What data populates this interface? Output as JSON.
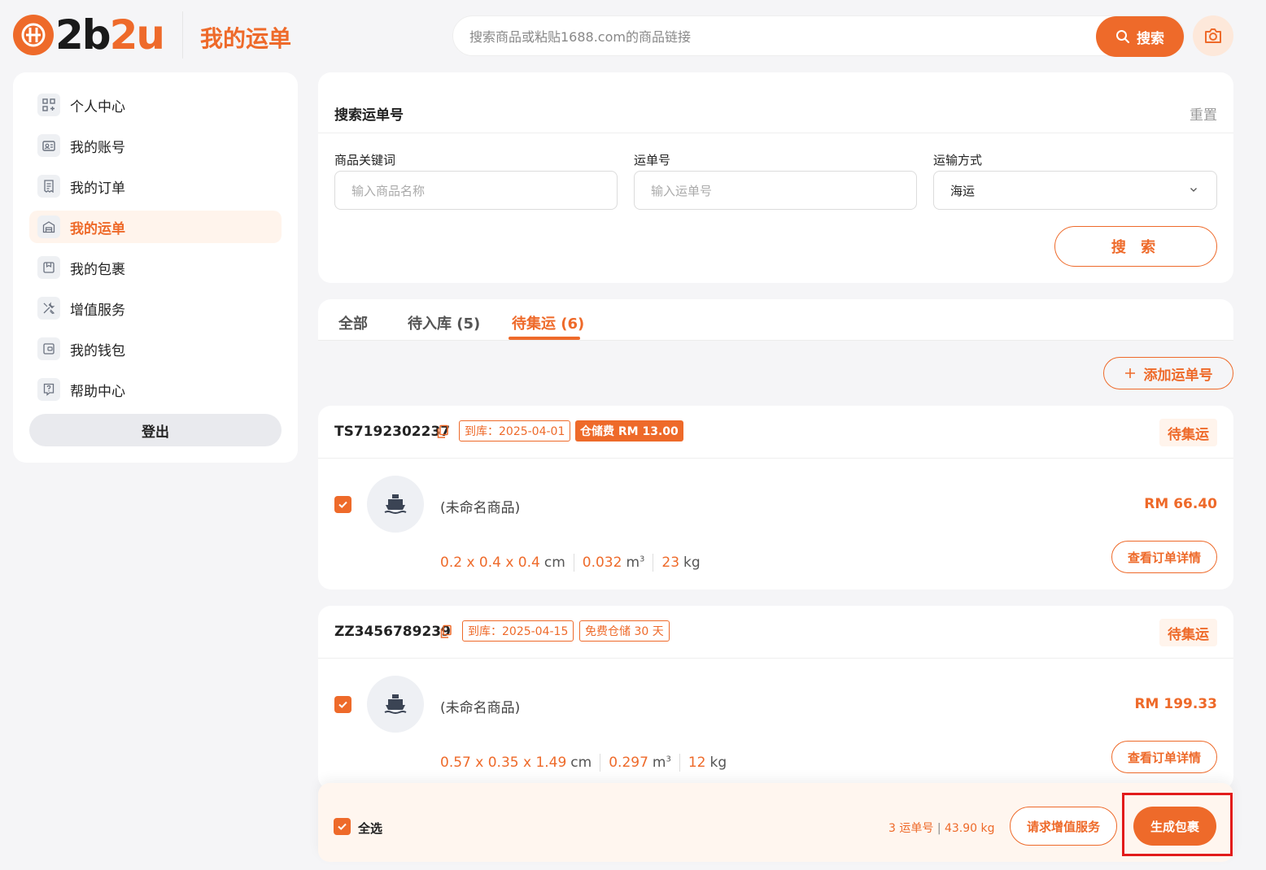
{
  "header": {
    "logo_text_a": "2b",
    "logo_text_b": "2u",
    "page_title": "我的运单",
    "search_placeholder": "搜索商品或粘贴1688.com的商品链接",
    "search_button": "搜索"
  },
  "sidebar": {
    "items": [
      {
        "label": "个人中心",
        "icon": "grid-icon"
      },
      {
        "label": "我的账号",
        "icon": "id-card-icon"
      },
      {
        "label": "我的订单",
        "icon": "receipt-icon"
      },
      {
        "label": "我的运单",
        "icon": "warehouse-icon",
        "active": true
      },
      {
        "label": "我的包裹",
        "icon": "package-icon"
      },
      {
        "label": "增值服务",
        "icon": "tools-icon"
      },
      {
        "label": "我的钱包",
        "icon": "wallet-icon"
      },
      {
        "label": "帮助中心",
        "icon": "help-icon"
      }
    ],
    "logout": "登出"
  },
  "filter": {
    "title": "搜索运单号",
    "reset": "重置",
    "keyword_label": "商品关键词",
    "keyword_placeholder": "输入商品名称",
    "waybill_label": "运单号",
    "waybill_placeholder": "输入运单号",
    "method_label": "运输方式",
    "method_value": "海运",
    "search_button": "搜 索"
  },
  "tabs": [
    {
      "label": "全部"
    },
    {
      "label": "待入库 (5)"
    },
    {
      "label": "待集运 (6)",
      "active": true
    }
  ],
  "add_waybill": "添加运单号",
  "waybills": [
    {
      "number": "TS7192302237",
      "arrival_tag": "到库：2025-04-01",
      "fee_tag": "仓储费 RM 13.00",
      "status": "待集运",
      "item_name": "(未命名商品)",
      "price": "RM 66.40",
      "dims": "0.2 x 0.4 x 0.4",
      "dims_unit": "cm",
      "volume": "0.032",
      "volume_unit": "m",
      "volume_sup": "3",
      "weight": "23",
      "weight_unit": "kg",
      "detail_button": "查看订单详情"
    },
    {
      "number": "ZZ3456789239",
      "arrival_tag": "到库：2025-04-15",
      "fee_tag": "免费仓储 30 天",
      "status": "待集运",
      "item_name": "(未命名商品)",
      "price": "RM 199.33",
      "dims": "0.57 x 0.35 x 1.49",
      "dims_unit": "cm",
      "volume": "0.297",
      "volume_unit": "m",
      "volume_sup": "3",
      "weight": "12",
      "weight_unit": "kg",
      "detail_button": "查看订单详情"
    }
  ],
  "bottom_bar": {
    "select_all": "全选",
    "summary_count": "3 运单号",
    "summary_sep": "|",
    "summary_weight": "43.90 kg",
    "vas_button": "请求增值服务",
    "generate_button": "生成包裹"
  },
  "colors": {
    "accent": "#ee6a2a",
    "highlight": "#e21b1b"
  }
}
